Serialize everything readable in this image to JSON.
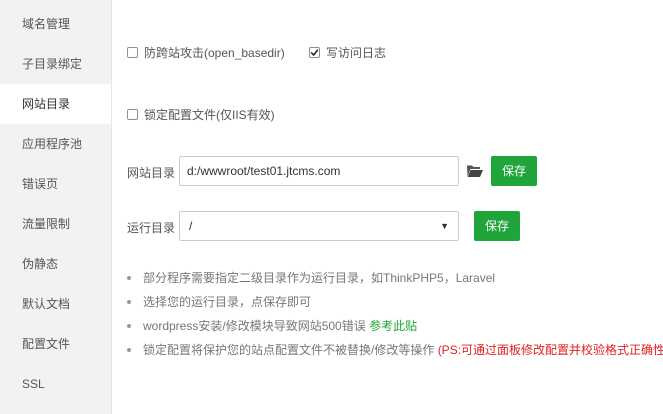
{
  "sidebar": {
    "items": [
      {
        "label": "域名管理"
      },
      {
        "label": "子目录绑定"
      },
      {
        "label": "网站目录"
      },
      {
        "label": "应用程序池"
      },
      {
        "label": "错误页"
      },
      {
        "label": "流量限制"
      },
      {
        "label": "伪静态"
      },
      {
        "label": "默认文档"
      },
      {
        "label": "配置文件"
      },
      {
        "label": "SSL"
      }
    ],
    "active_label": "网站目录"
  },
  "options": {
    "open_basedir": {
      "label": "防跨站攻击(open_basedir)",
      "checked": false
    },
    "access_log": {
      "label": "写访问日志",
      "checked": true
    },
    "lock_config": {
      "label": "锁定配置文件(仅IIS有效)",
      "checked": false
    }
  },
  "site_dir": {
    "label": "网站目录",
    "value": "d:/wwwroot/test01.jtcms.com",
    "folder_icon": "folder-open-icon",
    "save_label": "保存"
  },
  "run_dir": {
    "label": "运行目录",
    "selected": "/",
    "save_label": "保存"
  },
  "tips": {
    "t1": "部分程序需要指定二级目录作为运行目录，如ThinkPHP5，Laravel",
    "t2": "选择您的运行目录，点保存即可",
    "t3": "wordpress安装/修改模块导致网站500错误",
    "t3_link": "参考此贴",
    "t4": "锁定配置将保护您的站点配置文件不被替换/修改等操作",
    "t4_warning": "(PS:可通过面板修改配置并校验格式正确性"
  },
  "colors": {
    "accent": "#20a53a",
    "warning": "#e02020",
    "sidebar_bg": "#f2f2f2"
  }
}
